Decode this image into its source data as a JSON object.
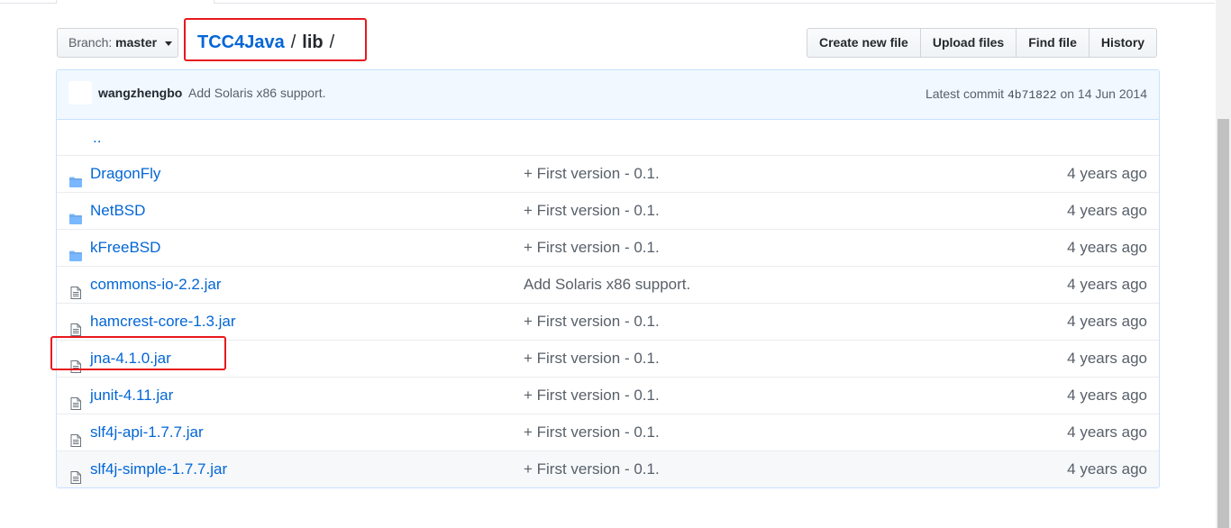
{
  "branch": {
    "label": "Branch:",
    "value": "master"
  },
  "breadcrumb": {
    "repo": "TCC4Java",
    "separator": "/",
    "dir": "lib",
    "trailing": "/"
  },
  "actions": {
    "create": "Create new file",
    "upload": "Upload files",
    "find": "Find file",
    "history": "History"
  },
  "latest_commit": {
    "author": "wangzhengbo",
    "message": "Add Solaris x86 support.",
    "prefix": "Latest commit",
    "sha": "4b71822",
    "date": "on 14 Jun 2014"
  },
  "parent_link": "..",
  "files": [
    {
      "type": "folder",
      "name": "DragonFly",
      "message": "+ First version - 0.1.",
      "age": "4 years ago"
    },
    {
      "type": "folder",
      "name": "NetBSD",
      "message": "+ First version - 0.1.",
      "age": "4 years ago"
    },
    {
      "type": "folder",
      "name": "kFreeBSD",
      "message": "+ First version - 0.1.",
      "age": "4 years ago"
    },
    {
      "type": "file",
      "name": "commons-io-2.2.jar",
      "message": "Add Solaris x86 support.",
      "age": "4 years ago"
    },
    {
      "type": "file",
      "name": "hamcrest-core-1.3.jar",
      "message": "+ First version - 0.1.",
      "age": "4 years ago"
    },
    {
      "type": "file",
      "name": "jna-4.1.0.jar",
      "message": "+ First version - 0.1.",
      "age": "4 years ago"
    },
    {
      "type": "file",
      "name": "junit-4.11.jar",
      "message": "+ First version - 0.1.",
      "age": "4 years ago"
    },
    {
      "type": "file",
      "name": "slf4j-api-1.7.7.jar",
      "message": "+ First version - 0.1.",
      "age": "4 years ago"
    },
    {
      "type": "file",
      "name": "slf4j-simple-1.7.7.jar",
      "message": "+ First version - 0.1.",
      "age": "4 years ago"
    }
  ],
  "colors": {
    "link": "#0366d6",
    "highlight": "#e8181c",
    "commit_bg": "#f1f8ff",
    "folder_icon": "#79b8ff"
  },
  "icons": {
    "folder": "folder-icon",
    "file": "file-icon",
    "caret": "caret-down-icon"
  }
}
